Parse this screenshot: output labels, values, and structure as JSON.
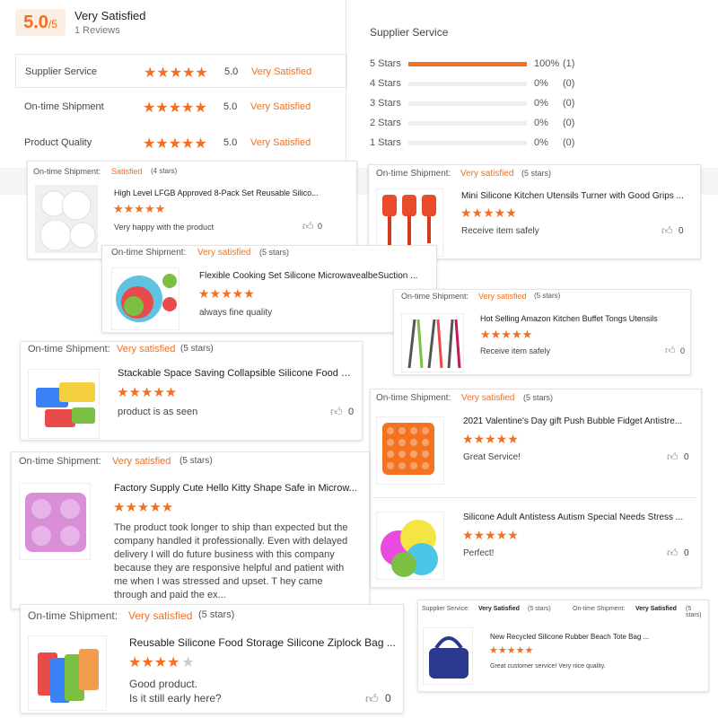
{
  "summary": {
    "score": "5.0",
    "score_max": "/5",
    "verdict": "Very Satisfied",
    "reviews": "1 Reviews",
    "rows": [
      {
        "label": "Supplier Service",
        "value": "5.0",
        "text": "Very Satisfied"
      },
      {
        "label": "On-time Shipment",
        "value": "5.0",
        "text": "Very Satisfied"
      },
      {
        "label": "Product Quality",
        "value": "5.0",
        "text": "Very Satisfied"
      }
    ]
  },
  "distribution": {
    "title": "Supplier Service",
    "rows": [
      {
        "label": "5 Stars",
        "pct": "100%",
        "count": "(1)",
        "fill": 1.0
      },
      {
        "label": "4 Stars",
        "pct": "0%",
        "count": "(0)",
        "fill": 0
      },
      {
        "label": "3 Stars",
        "pct": "0%",
        "count": "(0)",
        "fill": 0
      },
      {
        "label": "2 Stars",
        "pct": "0%",
        "count": "(0)",
        "fill": 0
      },
      {
        "label": "1 Stars",
        "pct": "0%",
        "count": "(0)",
        "fill": 0
      }
    ]
  },
  "reviews": [
    {
      "ship_label": "On-time Shipment:",
      "rating_text": "Satisfied",
      "rating_stars": "(4 stars)",
      "title": "High Level LFGB Approved 8-Pack Set Reusable Silico...",
      "stars": 5,
      "comment": "Very happy with the product",
      "likes": "0"
    },
    {
      "ship_label": "On-time Shipment:",
      "rating_text": "Very satisfied",
      "rating_stars": "(5 stars)",
      "title": "Mini Silicone Kitchen Utensils Turner with Good Grips ...",
      "stars": 5,
      "comment": "Receive item safely",
      "likes": "0"
    },
    {
      "ship_label": "On-time Shipment:",
      "rating_text": "Very satisfied",
      "rating_stars": "(5 stars)",
      "title": "Flexible Cooking Set Silicone MicrowavealbeSuction ...",
      "stars": 5,
      "comment": "always fine quality",
      "likes": ""
    },
    {
      "ship_label": "On-time Shipment:",
      "rating_text": "Very satisfied",
      "rating_stars": "(5 stars)",
      "title": "Hot Selling Amazon Kitchen Buffet Tongs Utensils",
      "stars": 5,
      "comment": "Receive item safely",
      "likes": "0"
    },
    {
      "ship_label": "On-time Shipment:",
      "rating_text": "Very satisfied",
      "rating_stars": "(5 stars)",
      "title": "Stackable Space Saving Collapsible Silicone Food Sto...",
      "stars": 5,
      "comment": "product is as seen",
      "likes": "0"
    },
    {
      "ship_label": "On-time Shipment:",
      "rating_text": "Very satisfied",
      "rating_stars": "(5 stars)",
      "title": "2021 Valentine's Day gift Push Bubble Fidget Antistre...",
      "stars": 5,
      "comment": "Great Service!",
      "likes": "0"
    },
    {
      "ship_label": "",
      "rating_text": "",
      "rating_stars": "",
      "title": "Silicone Adult Antistess Autism Special Needs Stress ...",
      "stars": 5,
      "comment": "Perfect!",
      "likes": "0"
    },
    {
      "ship_label": "On-time Shipment:",
      "rating_text": "Very satisfied",
      "rating_stars": "(5 stars)",
      "title": "Factory Supply Cute Hello Kitty Shape Safe in Microw...",
      "stars": 5,
      "comment": "The product took longer to ship than expected but the company handled it professionally. Even with delayed delivery I will do future business with this company because they are responsive helpful and patient with me when I was stressed and upset. T hey came through and paid the ex...",
      "likes": ""
    },
    {
      "ship_label": "On-time Shipment:",
      "rating_text": "Very satisfied",
      "rating_stars": "(5 stars)",
      "title": "Reusable Silicone Food Storage Silicone Ziplock Bag ...",
      "stars": 4,
      "comment": "Good product.\nIs it still early here?",
      "likes": "0"
    },
    {
      "ship_label": "",
      "rating_text": "",
      "rating_stars": "",
      "title": "New Recycled Silicone Rubber Beach Tote Bag ...",
      "stars": 5,
      "comment": "Great customer service! Very nice quality.",
      "likes": "",
      "supplier_label": "Supplier Service:",
      "supplier_text": "Very Satisfied",
      "supplier_stars": "(5 stars)",
      "ship_label2": "On-time Shipment:",
      "ship_text2": "Very Satisfied",
      "ship_stars2": "(5 stars)"
    }
  ],
  "colors": {
    "accent": "#f36f21",
    "badge_bg": "#fdeee4"
  }
}
